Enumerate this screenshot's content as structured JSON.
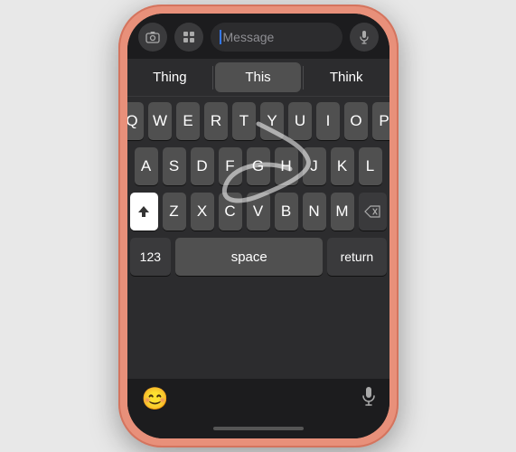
{
  "phone": {
    "topBar": {
      "cameraIcon": "📷",
      "appIcon": "🅐",
      "messagePlaceholder": "Message",
      "micIcon": "🎤"
    },
    "predictive": {
      "items": [
        "Thing",
        "This",
        "Think"
      ],
      "selectedIndex": 1
    },
    "keyboard": {
      "rows": [
        [
          "Q",
          "W",
          "E",
          "R",
          "T",
          "Y",
          "U",
          "I",
          "O",
          "P"
        ],
        [
          "A",
          "S",
          "D",
          "F",
          "G",
          "H",
          "J",
          "K",
          "L"
        ],
        [
          "Z",
          "X",
          "C",
          "V",
          "B",
          "N",
          "M"
        ]
      ],
      "specialKeys": {
        "shift": "⬆",
        "delete": "⌫",
        "numbers": "123",
        "space": "space",
        "return": "return"
      }
    },
    "bottomBar": {
      "emojiIcon": "😊",
      "micIcon": "🎤"
    }
  }
}
